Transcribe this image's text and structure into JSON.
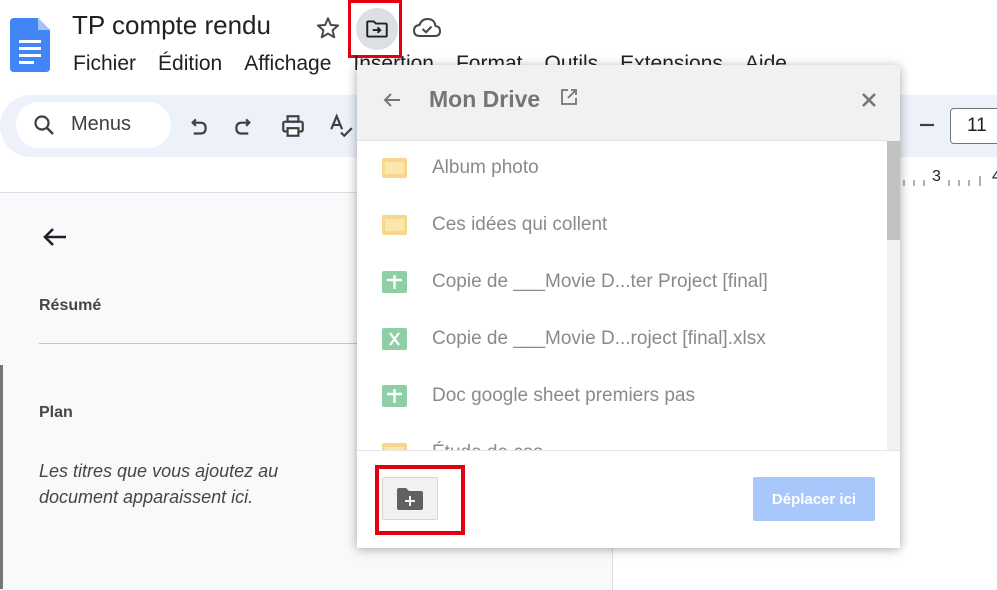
{
  "document": {
    "title": "TP compte rendu"
  },
  "menu": [
    "Fichier",
    "Édition",
    "Affichage",
    "Insertion",
    "Format",
    "Outils",
    "Extensions",
    "Aide"
  ],
  "toolbar": {
    "search_label": "Menus",
    "font_size": "11"
  },
  "ruler": {
    "tick_label": "3"
  },
  "outline": {
    "summary_label": "Résumé",
    "outline_label": "Plan",
    "hint": "Les titres que vous ajoutez au document apparaissent ici."
  },
  "move_dialog": {
    "title": "Mon Drive",
    "items": [
      {
        "label": "Album photo",
        "icon": "folder-icon"
      },
      {
        "label": "Ces idées qui collent",
        "icon": "folder-icon"
      },
      {
        "label": "Copie de ___Movie D...ter Project [final]",
        "icon": "sheets-icon"
      },
      {
        "label": "Copie de ___Movie D...roject [final].xlsx",
        "icon": "excel-icon"
      },
      {
        "label": "Doc google sheet premiers pas",
        "icon": "sheets-icon"
      },
      {
        "label": "Étude de cas",
        "icon": "folder-icon"
      }
    ],
    "move_here_label": "Déplacer ici"
  },
  "colors": {
    "highlight": "#e3000f",
    "toolbar_bg": "#edf2fa",
    "button_disabled": "#a8c7fa",
    "folder": "#f7cb4d",
    "sheets": "#0f9d58"
  }
}
